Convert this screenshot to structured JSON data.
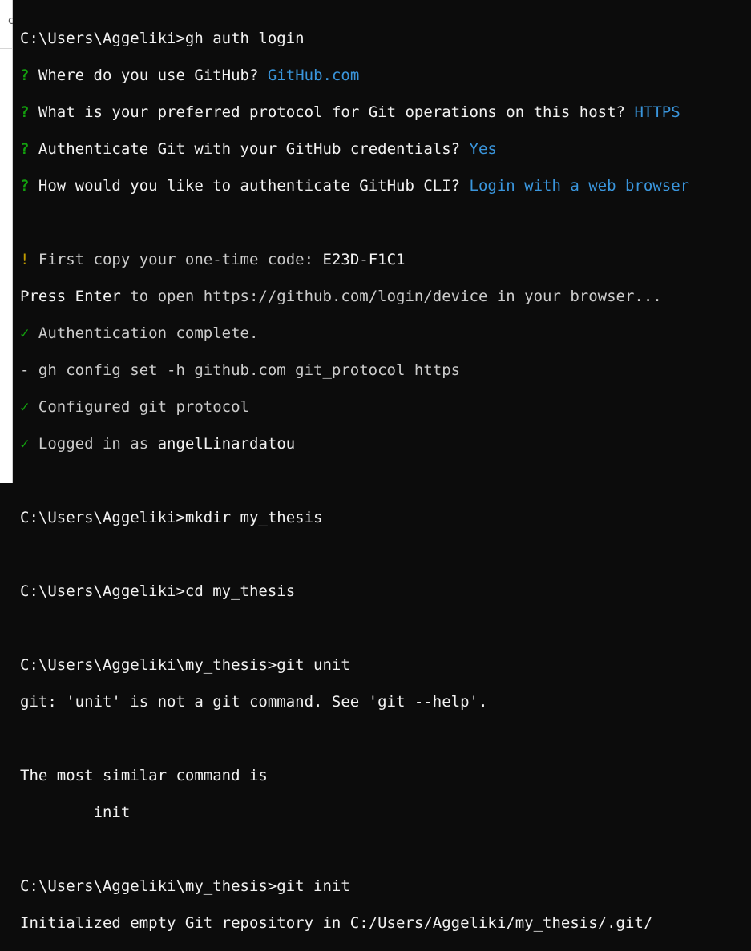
{
  "colors": {
    "background": "#0c0c0c",
    "text": "#cccccc",
    "bright_text": "#f2f2f2",
    "question_mark": "#13a10e",
    "answer": "#3a96dd",
    "warning": "#c19c00",
    "check": "#13a10e"
  },
  "lines": {
    "l01": "C:\\Users\\Aggeliki>gh auth login",
    "l02_mark": "?",
    "l02_text": " Where do you use GitHub? ",
    "l02_ans": "GitHub.com",
    "l03_mark": "?",
    "l03_text": " What is your preferred protocol for Git operations on this host? ",
    "l03_ans": "HTTPS",
    "l04_mark": "?",
    "l04_text": " Authenticate Git with your GitHub credentials? ",
    "l04_ans": "Yes",
    "l05_mark": "?",
    "l05_text": " How would you like to authenticate GitHub CLI? ",
    "l05_ans": "Login with a web browser",
    "l07_mark": "!",
    "l07_text": " First copy your one-time code: ",
    "l07_code": "E23D-F1C1",
    "l08_enter": "Press Enter",
    "l08_text": " to open https://github.com/login/device in your browser...",
    "l09_mark": "✓",
    "l09_text": " Authentication complete.",
    "l10": "- gh config set -h github.com git_protocol https",
    "l11_mark": "✓",
    "l11_text": " Configured git protocol",
    "l12_mark": "✓",
    "l12_text": " Logged in as ",
    "l12_user": "angelLinardatou",
    "l14": "C:\\Users\\Aggeliki>mkdir my_thesis",
    "l16": "C:\\Users\\Aggeliki>cd my_thesis",
    "l18": "C:\\Users\\Aggeliki\\my_thesis>git unit",
    "l19": "git: 'unit' is not a git command. See 'git --help'.",
    "l21": "The most similar command is",
    "l22": "        init",
    "l24": "C:\\Users\\Aggeliki\\my_thesis>git init",
    "l25": "Initialized empty Git repository in C:/Users/Aggeliki/my_thesis/.git/"
  },
  "left_window": {
    "fragment": "c"
  }
}
